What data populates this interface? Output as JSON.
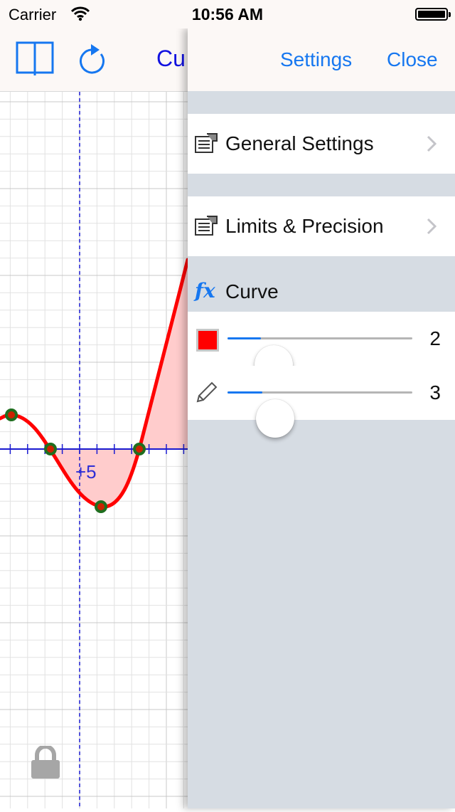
{
  "status_bar": {
    "carrier": "Carrier",
    "time": "10:56 AM",
    "wifi_icon": "wifi-icon",
    "battery_icon": "battery-icon"
  },
  "graph": {
    "toolbar_title": "Cu",
    "book_icon": "book-icon",
    "refresh_icon": "refresh-icon",
    "lock_icon": "lock-icon",
    "axis_label": "+5",
    "colors": {
      "curve": "#ff0000",
      "fill": "#ffcccc",
      "axis": "#1a1ad0",
      "point": "#1f6e1f",
      "grid": "#d4d4d4"
    }
  },
  "settings_panel": {
    "title": "Settings",
    "close_label": "Close",
    "items": [
      {
        "label": "General Settings",
        "icon": "settings-list-icon"
      },
      {
        "label": "Limits & Precision",
        "icon": "settings-list-icon"
      }
    ],
    "curve_section": {
      "header": "Curve",
      "header_icon": "fx-icon",
      "color_slider": {
        "value": "2",
        "color": "#ff0000",
        "fraction": 0.18
      },
      "width_slider": {
        "value": "3",
        "icon": "pencil-icon",
        "fraction": 0.19
      }
    },
    "colors": {
      "accent": "#1677f0",
      "background": "#d6dce3"
    }
  }
}
